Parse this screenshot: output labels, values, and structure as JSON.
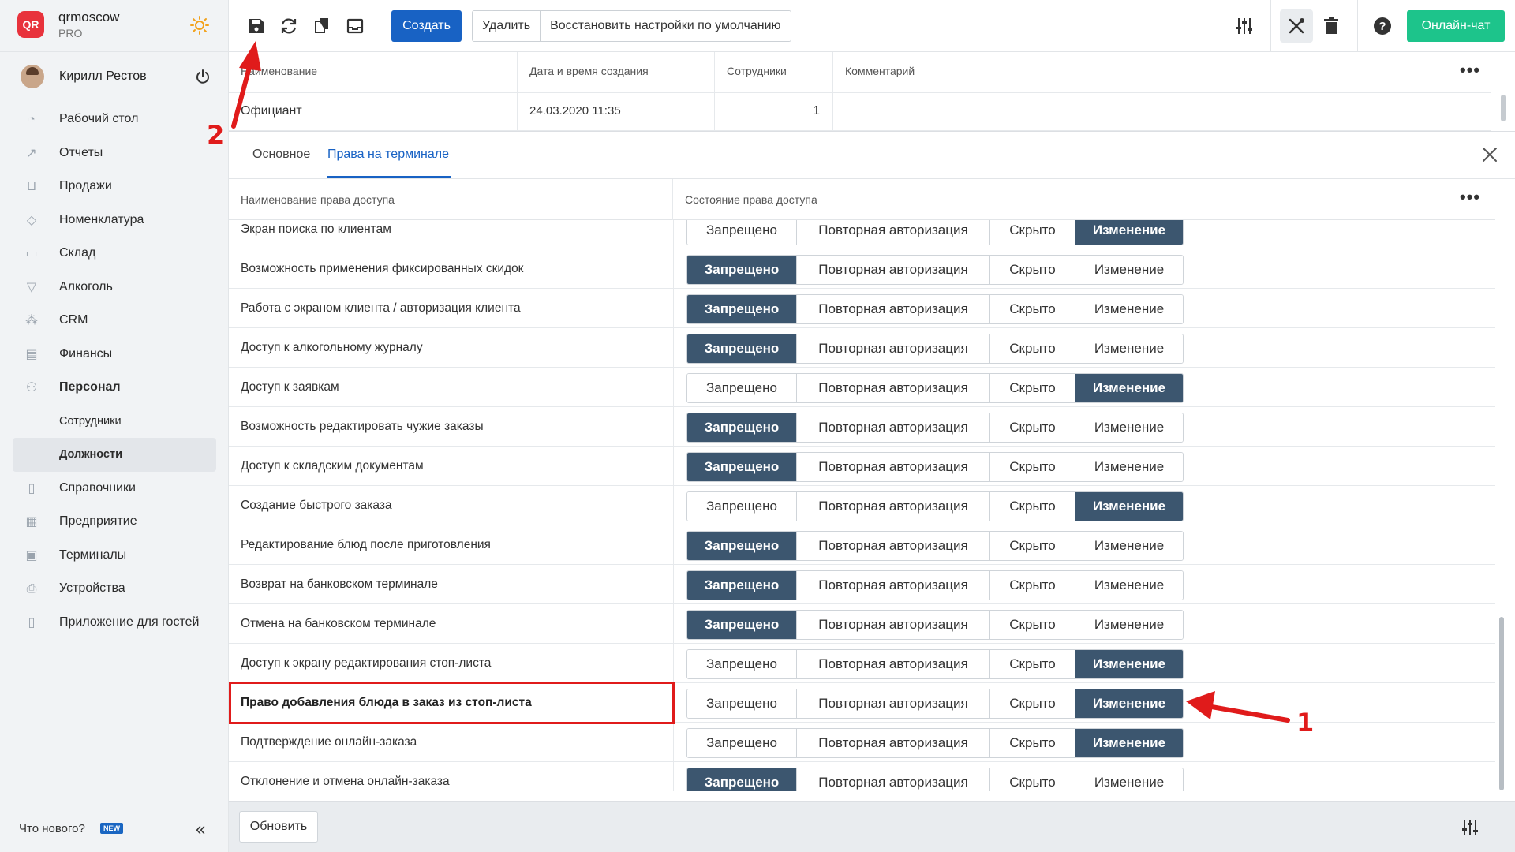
{
  "brand": {
    "name": "qrmoscow",
    "plan": "PRO",
    "logo_text": "QR"
  },
  "user": {
    "name": "Кирилл Рестов"
  },
  "nav": [
    {
      "label": "Рабочий стол",
      "icon": "dashboard-icon"
    },
    {
      "label": "Отчеты",
      "icon": "chart-icon"
    },
    {
      "label": "Продажи",
      "icon": "basket-icon"
    },
    {
      "label": "Номенклатура",
      "icon": "tag-icon"
    },
    {
      "label": "Склад",
      "icon": "box-icon"
    },
    {
      "label": "Алкоголь",
      "icon": "glass-icon"
    },
    {
      "label": "CRM",
      "icon": "crm-icon"
    },
    {
      "label": "Финансы",
      "icon": "wallet-icon"
    },
    {
      "label": "Персонал",
      "icon": "people-icon"
    },
    {
      "label": "Сотрудники"
    },
    {
      "label": "Должности"
    },
    {
      "label": "Справочники",
      "icon": "book-icon"
    },
    {
      "label": "Предприятие",
      "icon": "building-icon"
    },
    {
      "label": "Терминалы",
      "icon": "terminal-icon"
    },
    {
      "label": "Устройства",
      "icon": "printer-icon"
    },
    {
      "label": "Приложение для гостей",
      "icon": "phone-icon"
    }
  ],
  "footer": {
    "whats_new": "Что нового?",
    "new_badge": "NEW",
    "refresh": "Обновить"
  },
  "toolbar": {
    "create": "Создать",
    "delete": "Удалить",
    "restore_defaults": "Восстановить настройки по умолчанию",
    "online_chat": "Онлайн-чат"
  },
  "top_table": {
    "columns": [
      "Наименование",
      "Дата и время создания",
      "Сотрудники",
      "Комментарий"
    ],
    "row": {
      "name": "Официант",
      "created": "24.03.2020 11:35",
      "employees": "1",
      "comment": ""
    }
  },
  "tabs": [
    {
      "label": "Основное"
    },
    {
      "label": "Права на терминале"
    }
  ],
  "rights": {
    "columns": [
      "Наименование права доступа",
      "Состояние права доступа"
    ],
    "options": [
      "Запрещено",
      "Повторная авторизация",
      "Скрыто",
      "Изменение"
    ],
    "rows": [
      {
        "name": "Экран поиска по клиентам",
        "state": "Изменение"
      },
      {
        "name": "Возможность применения фиксированных скидок",
        "state": "Запрещено"
      },
      {
        "name": "Работа с экраном клиента / авторизация клиента",
        "state": "Запрещено"
      },
      {
        "name": "Доступ к алкогольному журналу",
        "state": "Запрещено"
      },
      {
        "name": "Доступ к заявкам",
        "state": "Изменение"
      },
      {
        "name": "Возможность редактировать чужие заказы",
        "state": "Запрещено"
      },
      {
        "name": "Доступ к складским документам",
        "state": "Запрещено"
      },
      {
        "name": "Создание быстрого заказа",
        "state": "Изменение"
      },
      {
        "name": "Редактирование блюд после приготовления",
        "state": "Запрещено"
      },
      {
        "name": "Возврат на банковском терминале",
        "state": "Запрещено"
      },
      {
        "name": "Отмена на банковском терминале",
        "state": "Запрещено"
      },
      {
        "name": "Доступ к экрану редактирования стоп-листа",
        "state": "Изменение"
      },
      {
        "name": "Право добавления блюда в заказ из стоп-листа",
        "state": "Изменение",
        "highlight": true
      },
      {
        "name": "Подтверждение онлайн-заказа",
        "state": "Изменение"
      },
      {
        "name": "Отклонение и отмена онлайн-заказа",
        "state": "Запрещено"
      }
    ]
  },
  "annotations": {
    "marker_1": "1",
    "marker_2": "2"
  },
  "colors": {
    "primary": "#1862c4",
    "selected_segment": "#3c566f",
    "chat": "#1dc48b",
    "annotation": "#e01b1b"
  }
}
